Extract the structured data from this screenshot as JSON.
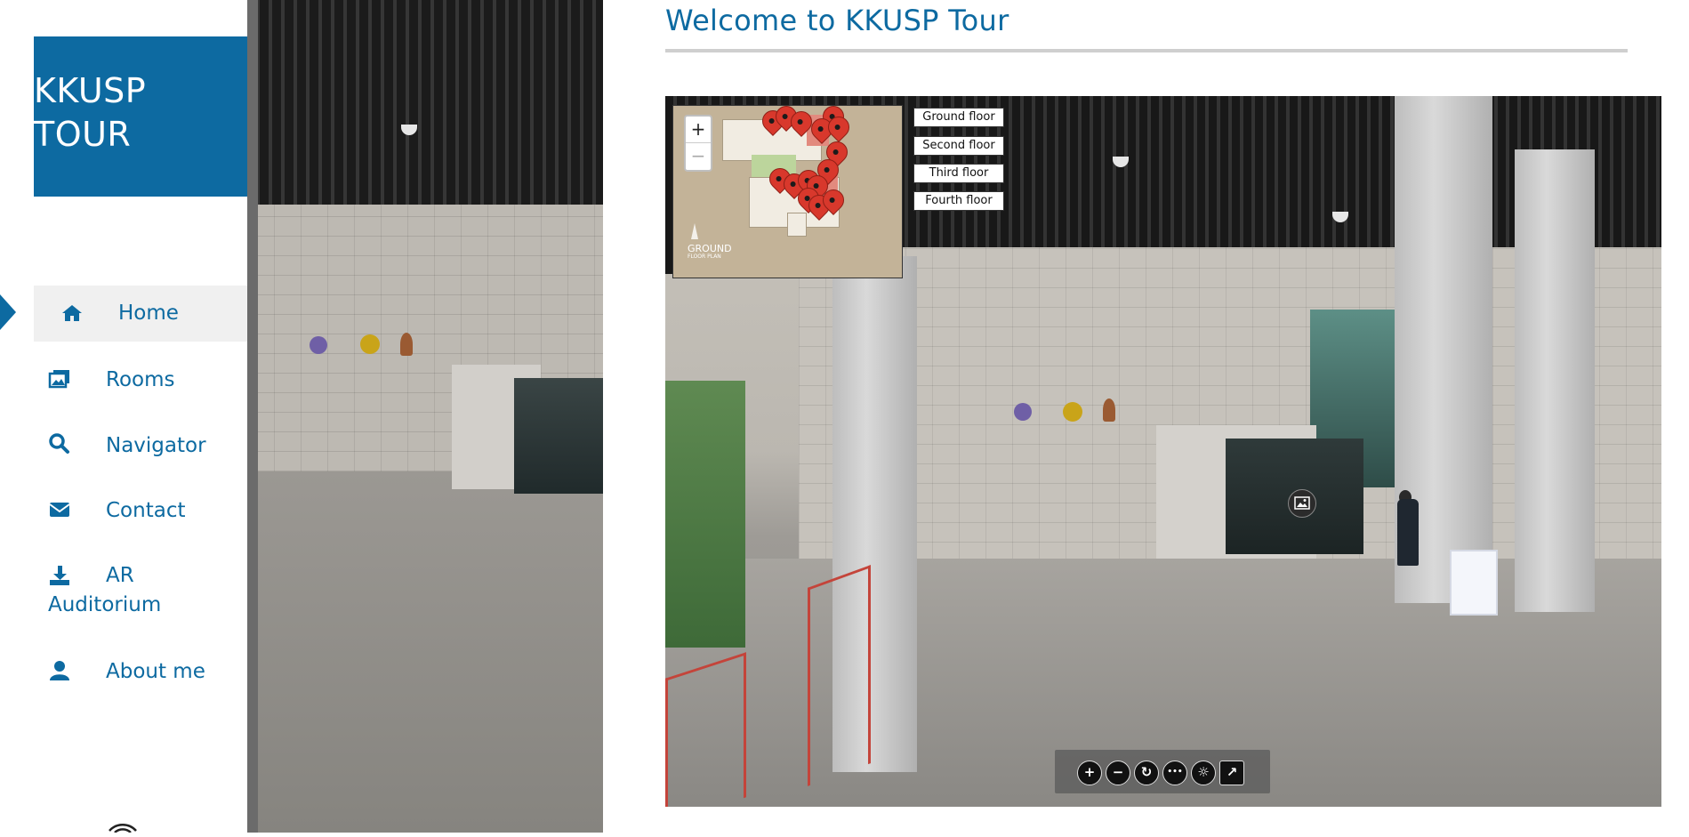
{
  "brand": {
    "line1": "KKUSP",
    "line2": "TOUR"
  },
  "nav": {
    "home": "Home",
    "rooms": "Rooms",
    "navigator": "Navigator",
    "contact": "Contact",
    "ar_line1": "AR",
    "ar_line2": "Auditorium",
    "about": "About me"
  },
  "page": {
    "title": "Welcome to KKUSP Tour"
  },
  "floor_map": {
    "zoom_in": "+",
    "zoom_out": "−",
    "caption": "GROUND",
    "caption_sub": "FLOOR PLAN"
  },
  "floors": [
    "Ground floor",
    "Second floor",
    "Third floor",
    "Fourth floor"
  ],
  "viewer_controls": {
    "zoom_in": "+",
    "zoom_out": "−",
    "rotate": "↻",
    "more": "•••",
    "gyro": "☼",
    "fullscreen": "↗"
  },
  "colors": {
    "accent": "#0d6aa1",
    "rule": "#cfcfcf",
    "pin": "#d8382c"
  }
}
